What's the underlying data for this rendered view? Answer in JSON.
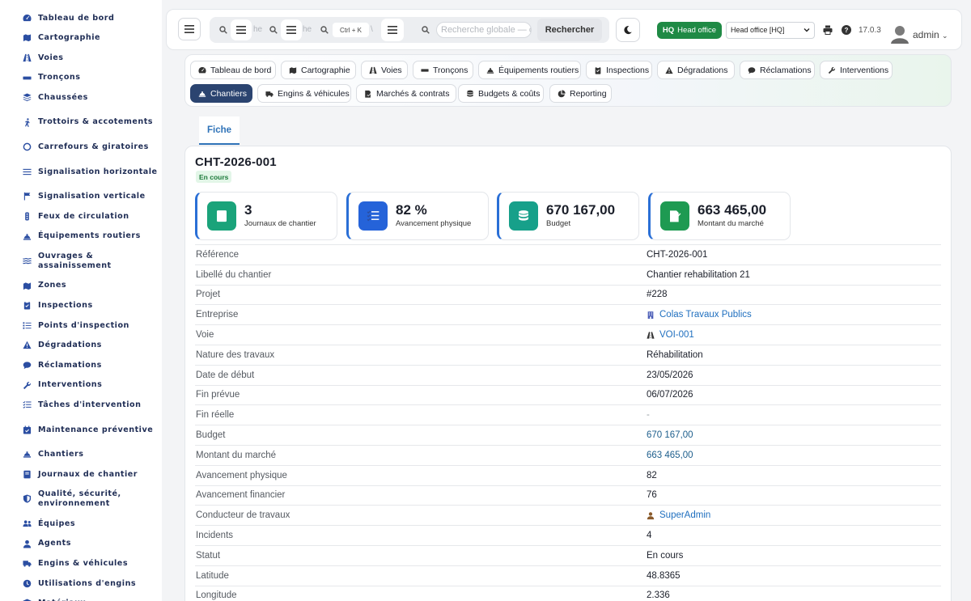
{
  "sidebar": {
    "items": [
      {
        "label": "Tableau de bord",
        "icon": "dashboard-icon"
      },
      {
        "label": "Cartographie",
        "icon": "map-icon"
      },
      {
        "label": "Voies",
        "icon": "road-icon"
      },
      {
        "label": "Tronçons",
        "icon": "segment-icon"
      },
      {
        "label": "Chaussées",
        "icon": "layers-icon"
      },
      {
        "label": "Trottoirs & accotements",
        "icon": "walking-icon"
      },
      {
        "label": "Carrefours & giratoires",
        "icon": "circle-icon"
      },
      {
        "label": "Signalisation horizontale",
        "icon": "lines-icon"
      },
      {
        "label": "Signalisation verticale",
        "icon": "sign-icon"
      },
      {
        "label": "Feux de circulation",
        "icon": "traffic-light-icon"
      },
      {
        "label": "Équipements routiers",
        "icon": "hard-hat-icon"
      },
      {
        "label": "Ouvrages & assainissement",
        "icon": "water-icon"
      },
      {
        "label": "Zones",
        "icon": "zones-icon"
      },
      {
        "label": "Inspections",
        "icon": "clipboard-icon"
      },
      {
        "label": "Points d'inspection",
        "icon": "list-icon"
      },
      {
        "label": "Dégradations",
        "icon": "warning-icon"
      },
      {
        "label": "Réclamations",
        "icon": "comment-icon"
      },
      {
        "label": "Interventions",
        "icon": "wrench-icon"
      },
      {
        "label": "Tâches d'intervention",
        "icon": "tasks-icon"
      },
      {
        "label": "Maintenance préventive",
        "icon": "calendar-icon"
      },
      {
        "label": "Chantiers",
        "icon": "hard-hat-icon"
      },
      {
        "label": "Journaux de chantier",
        "icon": "book-icon"
      },
      {
        "label": "Qualité, sécurité, environnement",
        "icon": "shield-icon"
      },
      {
        "label": "Équipes",
        "icon": "users-icon"
      },
      {
        "label": "Agents",
        "icon": "user-icon"
      },
      {
        "label": "Engins & véhicules",
        "icon": "truck-icon"
      },
      {
        "label": "Utilisations d'engins",
        "icon": "clock-icon"
      },
      {
        "label": "Matériaux",
        "icon": "box-icon"
      }
    ]
  },
  "topbar": {
    "search_fragment_1": "he",
    "search_fragment_2": "he",
    "shortcut": "Ctrl + K",
    "search_fragment_3": "\\",
    "global_search_placeholder": "Recherche globale — ct",
    "search_button": "Rechercher",
    "hq_code": "HQ",
    "hq_label": "Head office",
    "office_select": "Head office [HQ]",
    "version": "17.0.3",
    "user": "admin"
  },
  "modules": {
    "tabs": [
      {
        "label": "Tableau de bord",
        "icon": "dashboard-icon"
      },
      {
        "label": "Cartographie",
        "icon": "map-icon"
      },
      {
        "label": "Voies",
        "icon": "road-icon"
      },
      {
        "label": "Tronçons",
        "icon": "segment-icon"
      },
      {
        "label": "Équipements routiers",
        "icon": "hard-hat-icon"
      },
      {
        "label": "Inspections",
        "icon": "clipboard-icon"
      },
      {
        "label": "Dégradations",
        "icon": "warning-icon"
      },
      {
        "label": "Réclamations",
        "icon": "comment-icon"
      },
      {
        "label": "Interventions",
        "icon": "wrench-icon"
      },
      {
        "label": "Chantiers",
        "icon": "hard-hat-icon",
        "active": true
      },
      {
        "label": "Engins & véhicules",
        "icon": "truck-icon"
      },
      {
        "label": "Marchés & contrats",
        "icon": "contract-icon"
      },
      {
        "label": "Budgets & coûts",
        "icon": "coins-icon"
      },
      {
        "label": "Reporting",
        "icon": "chart-pie-icon"
      }
    ]
  },
  "record": {
    "tab_label": "Fiche",
    "title": "CHT-2026-001",
    "status": "En cours",
    "stats": [
      {
        "value": "3",
        "label": "Journaux de chantier",
        "icon": "book-icon",
        "color": "#1aa37a"
      },
      {
        "value": "82 %",
        "label": "Avancement physique",
        "icon": "tasks-icon",
        "color": "#2563d9"
      },
      {
        "value": "670 167,00",
        "label": "Budget",
        "icon": "coins-icon",
        "color": "#17a08a"
      },
      {
        "value": "663 465,00",
        "label": "Montant du marché",
        "icon": "contract-icon",
        "color": "#1e9a52"
      }
    ],
    "fields": [
      {
        "key": "Référence",
        "value": "CHT-2026-001",
        "style": ""
      },
      {
        "key": "Libellé du chantier",
        "value": "Chantier rehabilitation 21",
        "style": ""
      },
      {
        "key": "Projet",
        "value": "#228",
        "style": ""
      },
      {
        "key": "Entreprise",
        "value": "Colas Travaux Publics",
        "style": "link",
        "icon": "building-icon"
      },
      {
        "key": "Voie",
        "value": "VOI-001",
        "style": "link",
        "icon": "road-icon"
      },
      {
        "key": "Nature des travaux",
        "value": "Réhabilitation",
        "style": ""
      },
      {
        "key": "Date de début",
        "value": "23/05/2026",
        "style": ""
      },
      {
        "key": "Fin prévue",
        "value": "06/07/2026",
        "style": ""
      },
      {
        "key": "Fin réelle",
        "value": "-",
        "style": "muted"
      },
      {
        "key": "Budget",
        "value": "670 167,00",
        "style": "money"
      },
      {
        "key": "Montant du marché",
        "value": "663 465,00",
        "style": "money"
      },
      {
        "key": "Avancement physique",
        "value": "82",
        "style": ""
      },
      {
        "key": "Avancement financier",
        "value": "76",
        "style": ""
      },
      {
        "key": "Conducteur de travaux",
        "value": "SuperAdmin",
        "style": "link",
        "icon": "user-icon"
      },
      {
        "key": "Incidents",
        "value": "4",
        "style": ""
      },
      {
        "key": "Statut",
        "value": "En cours",
        "style": ""
      },
      {
        "key": "Latitude",
        "value": "48.8365",
        "style": ""
      },
      {
        "key": "Longitude",
        "value": "2.336",
        "style": ""
      }
    ]
  },
  "colors": {
    "accent": "#2f73b8",
    "active_tab": "#2b4470",
    "hq_badge": "#1f8a45",
    "sidebar_text": "#1f2d55"
  }
}
